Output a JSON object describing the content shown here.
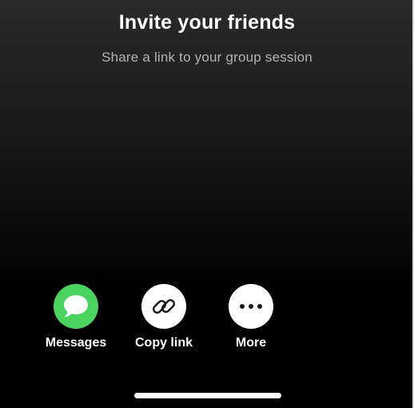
{
  "header": {
    "title": "Invite your friends",
    "subtitle": "Share a link to your group session"
  },
  "share_options": [
    {
      "label": "Messages",
      "icon": "messages-icon",
      "color": "#4bd35f"
    },
    {
      "label": "Copy link",
      "icon": "link-icon",
      "color": "#ffffff"
    },
    {
      "label": "More",
      "icon": "more-dots-icon",
      "color": "#ffffff"
    }
  ],
  "colors": {
    "background_top": "#2a2a2a",
    "background_bottom": "#000000",
    "subtitle_text": "#b3b3b3",
    "messages_green": "#4bd35f"
  }
}
